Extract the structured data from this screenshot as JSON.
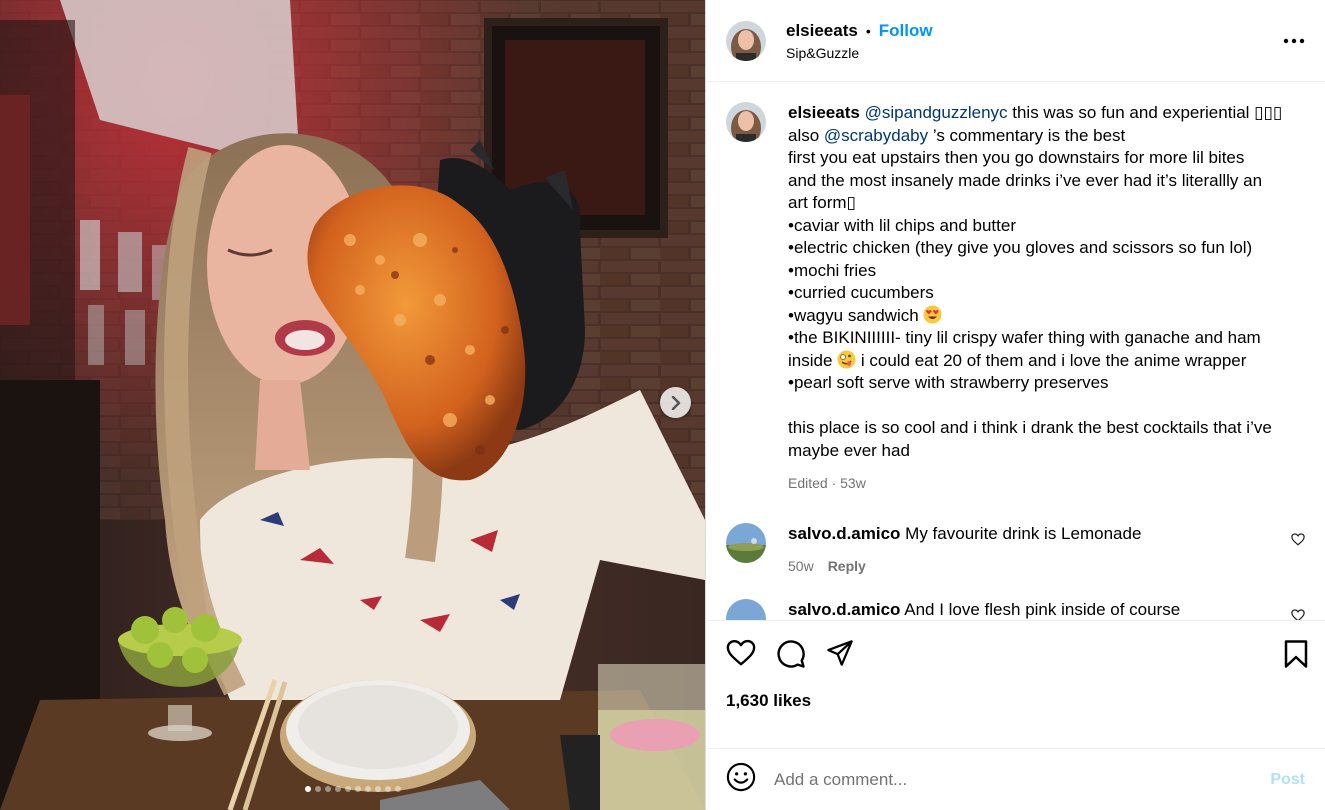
{
  "post": {
    "username": "elsieeats",
    "separator": "•",
    "follow_label": "Follow",
    "location": "Sip&Guzzle",
    "more_icon": "more-horizontal-icon"
  },
  "caption": {
    "username": "elsieeats",
    "mention1": "@sipandguzzlenyc",
    "text1": " this was so fun and experiential ▯▯▯",
    "text2": "also ",
    "mention2": "@scrabydaby",
    "text3": " ’s commentary is the best",
    "line3": "first you eat upstairs then you go downstairs for more lil bites",
    "line4": "and the most insanely made drinks i’ve ever had it’s literallly an",
    "line5": "art form▯",
    "line6": "•caviar with lil chips and butter",
    "line7": "•electric chicken (they give you gloves and scissors so fun lol)",
    "line8": "•mochi fries",
    "line9": "•curried cucumbers",
    "line10": "•wagyu sandwich ",
    "line11": "•the BIKINIIIIII- tiny lil crispy wafer thing with ganache and ham",
    "line12a": "inside ",
    "line12b": " i could eat 20 of them and i love the anime wrapper",
    "line13": "•pearl soft serve with strawberry preserves",
    "line14": "this place is so cool and i think i drank the best cocktails that i’ve",
    "line15": "maybe ever had",
    "meta": "Edited · 53w"
  },
  "comments": [
    {
      "username": "salvo.d.amico",
      "text": "My favourite drink is Lemonade",
      "age": "50w",
      "reply": "Reply"
    },
    {
      "username": "salvo.d.amico",
      "text": "And I love flesh pink inside of course"
    }
  ],
  "likes": "1,630 likes",
  "add_comment": {
    "placeholder": "Add a comment...",
    "post_label": "Post"
  },
  "carousel": {
    "slide_count": 10,
    "active_index": 0
  }
}
